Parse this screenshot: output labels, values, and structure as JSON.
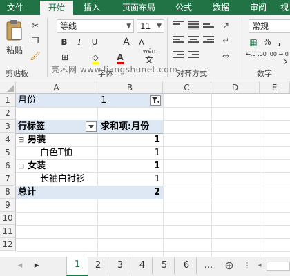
{
  "ribbon_tabs": [
    "文件",
    "开始",
    "插入",
    "页面布局",
    "公式",
    "数据",
    "审阅",
    "视"
  ],
  "clipboard": {
    "paste_label": "粘贴",
    "group_label": "剪贴板"
  },
  "font": {
    "name": "等线",
    "size": "11",
    "group_label": "字体",
    "bold": "B",
    "italic": "I",
    "underline": "U",
    "grow": "A",
    "shrink": "A",
    "wen": "wén",
    "wen_char": "文"
  },
  "align": {
    "group_label": "对齐方式"
  },
  "number": {
    "format": "常规",
    "group_label": "数字",
    "percent": "%",
    "comma": ",",
    "dec_inc": "←.0 .00",
    "dec_dec": ".00 →.0"
  },
  "watermark": "亮术网 www.liangshunet.com",
  "columns": [
    "A",
    "B",
    "C",
    "D",
    "E"
  ],
  "rows": [
    "1",
    "2",
    "3",
    "4",
    "5",
    "6",
    "7",
    "8",
    "9",
    "10",
    "11",
    "12"
  ],
  "pivot": {
    "filter_label": "月份",
    "filter_value": "1",
    "row_label_header": "行标签",
    "value_header": "求和项:月份",
    "rows": [
      {
        "label": "男装",
        "value": "1"
      },
      {
        "label": "白色T恤",
        "value": "1"
      },
      {
        "label": "女装",
        "value": "1"
      },
      {
        "label": "长袖白衬衫",
        "value": "1"
      }
    ],
    "total_label": "总计",
    "total_value": "2",
    "collapse_symbol": "⊟"
  },
  "sheet_tabs": [
    "1",
    "2",
    "3",
    "4",
    "5",
    "6"
  ],
  "sheet_nav": {
    "prev": "◂",
    "next": "▸",
    "more": "...",
    "add": "⊕"
  }
}
